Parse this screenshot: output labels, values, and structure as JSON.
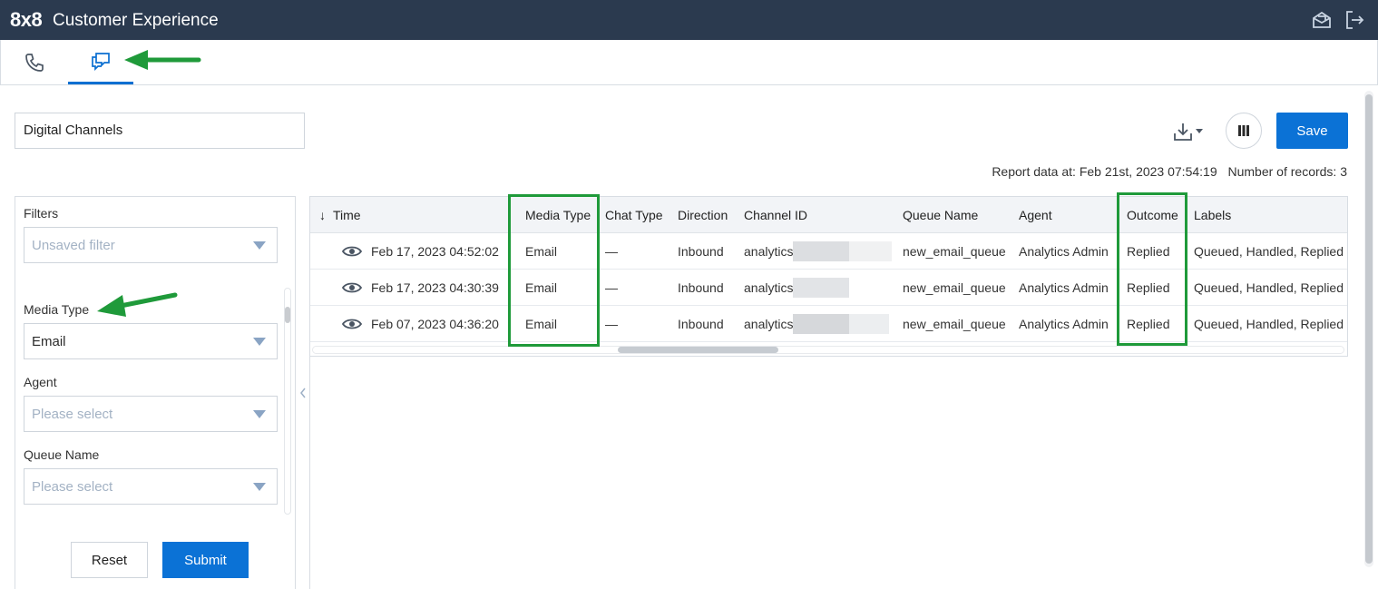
{
  "header": {
    "brand": "8x8",
    "title": "Customer Experience",
    "icons": [
      "mail-open-icon",
      "logout-icon"
    ]
  },
  "tabs": [
    {
      "icon": "phone-icon",
      "active": false
    },
    {
      "icon": "chat-icon",
      "active": true
    }
  ],
  "report": {
    "name": "Digital Channels",
    "save_label": "Save",
    "data_at": "Report data at: Feb 21st, 2023 07:54:19",
    "record_count": "Number of records: 3"
  },
  "filters": {
    "title": "Filters",
    "saved_filter_placeholder": "Unsaved filter",
    "media_type_label": "Media Type",
    "media_type_value": "Email",
    "agent_label": "Agent",
    "agent_placeholder": "Please select",
    "queue_label": "Queue Name",
    "queue_placeholder": "Please select",
    "reset_label": "Reset",
    "submit_label": "Submit"
  },
  "table": {
    "sort_arrow": "↓",
    "columns": [
      "Time",
      "Media Type",
      "Chat Type",
      "Direction",
      "Channel ID",
      "Queue Name",
      "Agent",
      "Outcome",
      "Labels"
    ],
    "rows": [
      {
        "time": "Feb 17, 2023 04:52:02",
        "media_type": "Email",
        "chat_type": "—",
        "direction": "Inbound",
        "channel_id": "analytics",
        "queue": "new_email_queue",
        "agent": "Analytics Admin",
        "outcome": "Replied",
        "labels": "Queued, Handled, Replied"
      },
      {
        "time": "Feb 17, 2023 04:30:39",
        "media_type": "Email",
        "chat_type": "—",
        "direction": "Inbound",
        "channel_id": "analytics",
        "queue": "new_email_queue",
        "agent": "Analytics Admin",
        "outcome": "Replied",
        "labels": "Queued, Handled, Replied"
      },
      {
        "time": "Feb 07, 2023 04:36:20",
        "media_type": "Email",
        "chat_type": "—",
        "direction": "Inbound",
        "channel_id": "analytics",
        "queue": "new_email_queue",
        "agent": "Analytics Admin",
        "outcome": "Replied",
        "labels": "Queued, Handled, Replied"
      }
    ]
  },
  "colors": {
    "header_bg": "#2b3a4f",
    "accent": "#0b72d6",
    "highlight": "#1f9a3a"
  }
}
